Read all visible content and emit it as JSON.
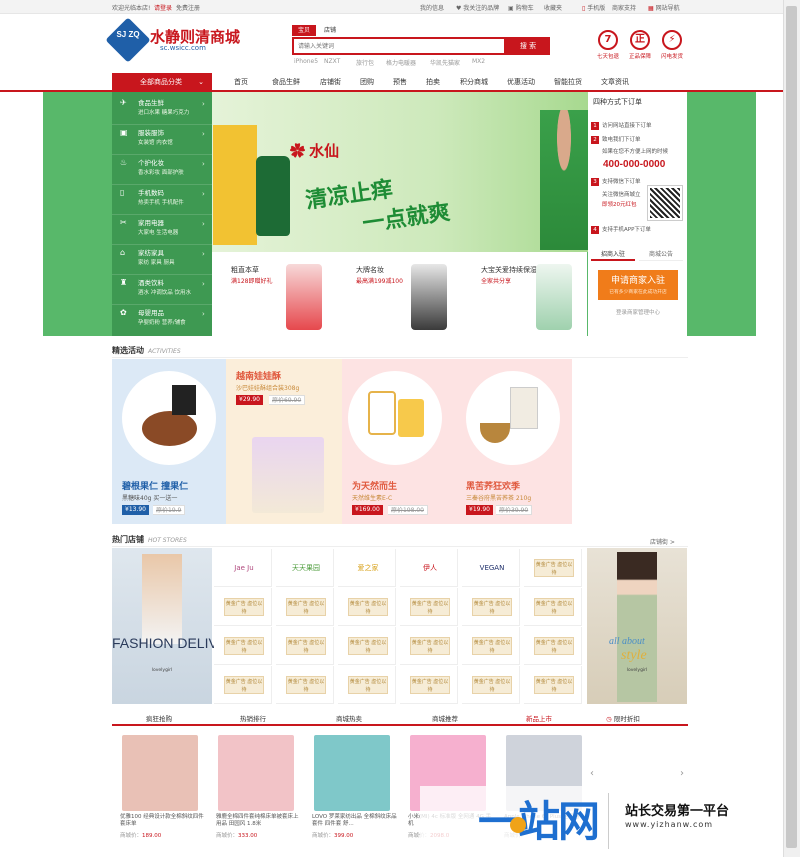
{
  "topbar": {
    "welcome": "欢迎光临本店!",
    "login": "请登录",
    "register": "免费注册",
    "links": [
      "我的信息",
      "我关注的品牌",
      "购物车",
      "收藏夹",
      "手机版",
      "商家支持",
      "网站导航"
    ]
  },
  "logo": {
    "mark": "SJ ZQ",
    "name": "水静则清商城",
    "url": "sc.wsicc.com"
  },
  "search": {
    "tabs": [
      "宝贝",
      "店铺"
    ],
    "placeholder": "请输入关键词",
    "button": "搜 索",
    "hot_words": [
      "iPhone5",
      "NZXT",
      "旅行包",
      "格力电暖器",
      "华凯先猫家",
      "MX2"
    ]
  },
  "services": [
    {
      "icon": "7",
      "label": "七天包退"
    },
    {
      "icon": "正",
      "label": "正品保障"
    },
    {
      "icon": "⚡",
      "label": "闪电发货"
    }
  ],
  "nav": {
    "category_head": "全部商品分类",
    "items": [
      "首页",
      "食品生鲜",
      "店铺街",
      "团购",
      "预售",
      "拍卖",
      "积分商城",
      "优惠活动",
      "智能拉货",
      "文章资讯"
    ]
  },
  "categories": [
    {
      "icon": "✈",
      "title": "食品生鲜",
      "sub": "进口水果  糖果巧克力"
    },
    {
      "icon": "▣",
      "title": "服装服饰",
      "sub": "女装馆  内衣馆"
    },
    {
      "icon": "♨",
      "title": "个护化妆",
      "sub": "香水彩妆  面部护肤"
    },
    {
      "icon": "▯",
      "title": "手机数码",
      "sub": "热卖手机  手机配件"
    },
    {
      "icon": "✂",
      "title": "家用电器",
      "sub": "大家电  生活电器"
    },
    {
      "icon": "⌂",
      "title": "家纺家具",
      "sub": "家纺  家具  厨具"
    },
    {
      "icon": "♜",
      "title": "酒类饮料",
      "sub": "酒水  冲调饮品  饮用水"
    },
    {
      "icon": "✿",
      "title": "母婴用品",
      "sub": "孕婴奶粉  营养/辅食"
    }
  ],
  "banner": {
    "brand": "水仙",
    "line1": "清凉止痒",
    "line2": "一点就爽"
  },
  "mini_promos": [
    {
      "title": "粗直本草",
      "sub": "满128即赠好礼"
    },
    {
      "title": "大牌名妆",
      "sub": "最高满199减100"
    },
    {
      "title": "大宝关爱持续保湿",
      "sub": "全家共分享"
    }
  ],
  "right_panel": {
    "title": "四种方式下订单",
    "steps": [
      {
        "num": "1",
        "text": "访问网站直接下订单"
      },
      {
        "num": "2",
        "text": "致电我们下订单"
      },
      {
        "num": "",
        "text": "如果在您不方便上网的时候"
      },
      {
        "num": "3",
        "text": "支持微信下订单"
      },
      {
        "num": "",
        "text": "关注微信商城立"
      },
      {
        "num": "",
        "text": "即领20元红包"
      },
      {
        "num": "4",
        "text": "支持手机APP下订单"
      }
    ],
    "phone": "400-000-0000",
    "tabs": [
      "招商入驻",
      "商城公告"
    ],
    "merchant_title": "申请商家入驻",
    "merchant_sub": "已有多少商家在此成功开店",
    "merchant_link": "登录商家管理中心"
  },
  "activities": {
    "title": "精选活动",
    "subtitle": "ACTIVITIES",
    "items": [
      {
        "title": "碧根果仁 撞果仁",
        "sub": "黑糖味40g 买一送一",
        "price": "¥13.90",
        "old": "原价19.9",
        "bg": "#dce9f6"
      },
      {
        "title": "越南娃娃酥",
        "sub": "沙巴娃娃酥组合装308g",
        "price": "¥29.90",
        "old": "原价69.90",
        "bg": "#fbeeda"
      },
      {
        "title": "为天然而生",
        "sub": "天然维生素E-C",
        "price": "¥169.00",
        "old": "原价198.00",
        "bg": "#fde3e3"
      },
      {
        "title": "黑苦荞狂欢季",
        "sub": "三秦谷府黑苦荞茶 210g",
        "price": "¥19.90",
        "old": "原价39.90",
        "bg": "#fde3e3"
      }
    ]
  },
  "stores": {
    "title": "热门店铺",
    "subtitle": "HOT STORES",
    "more": "店铺街 >",
    "named": [
      "Jae Ju",
      "天天果园",
      "爱之家",
      "伊人",
      "VEGAN"
    ],
    "placeholder": "黄金广告 虚位以待",
    "left_text": "FASHION DELIVERS",
    "left_small": "lovelygirl",
    "right_text1": "all about",
    "right_text2": "style",
    "right_small": "lovelygirl"
  },
  "bottom_tabs": [
    "疯狂抢购",
    "热销排行",
    "商城热卖",
    "商城推荐",
    "新品上市",
    "限时折扣"
  ],
  "products": [
    {
      "name": "优雅100 经典设计款全棉斜纹四件套床单",
      "price_label": "商城价：",
      "price": "189.00",
      "color": "#e9c1b6"
    },
    {
      "name": "雅鹿全棉四件套纯棉床单被套床上用品 田园风 1.8米",
      "price_label": "商城价：",
      "price": "333.00",
      "color": "#f2c3c7"
    },
    {
      "name": "LOVO 罗莱家纺出品 全棉斜纹床品套件 四件套 舒...",
      "price_label": "商城价：",
      "price": "399.00",
      "color": "#7fc8c9"
    },
    {
      "name": "小米(MI) 4c 标准版 全网通 4G 手机",
      "price_label": "商城价：",
      "price": "2098.0",
      "color": "#f6b0cf"
    },
    {
      "name": "Apple iPhone 6s Plus 全网通",
      "price_label": "商城价：",
      "price": "",
      "color": "#cfd3db"
    }
  ],
  "watermark": {
    "big": "一站网",
    "slogan": "站长交易第一平台",
    "url": "www.yizhanw.com"
  },
  "colors": {
    "brand_red": "#c8161d",
    "banner_green": "#58b86a",
    "logo_blue": "#1f5fa8",
    "accent_orange": "#f07c1a"
  }
}
